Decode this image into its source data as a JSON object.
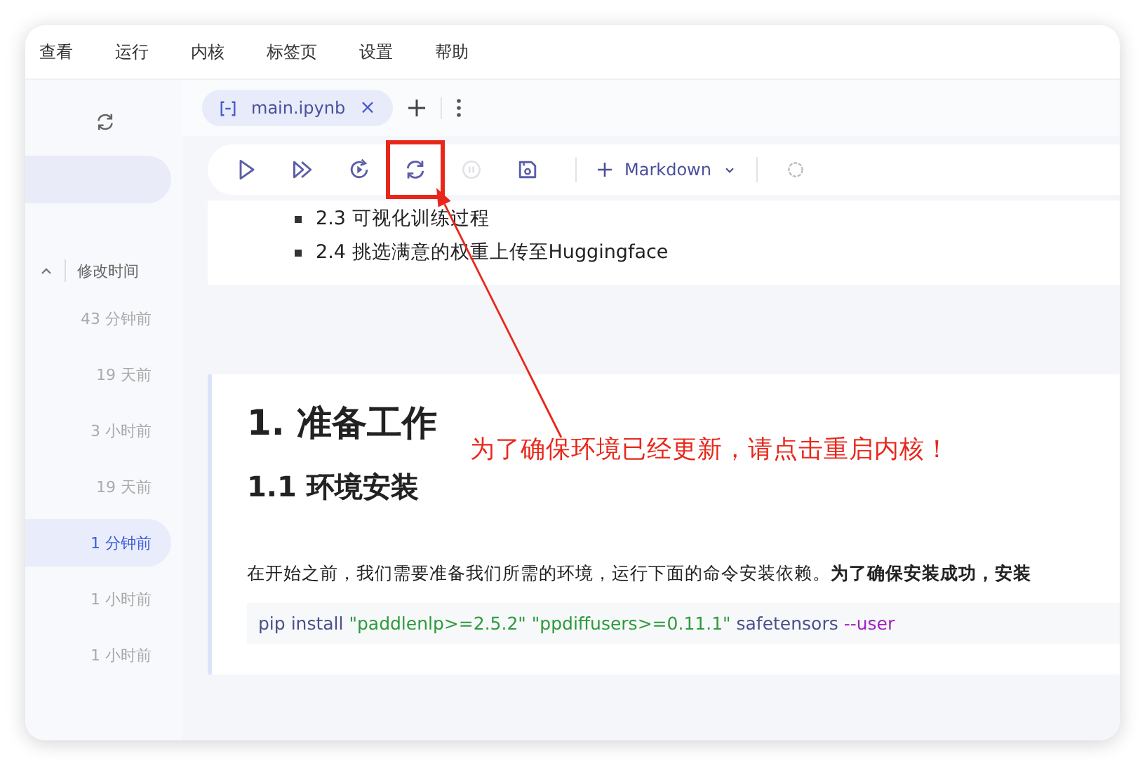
{
  "menu": [
    "查看",
    "运行",
    "内核",
    "标签页",
    "设置",
    "帮助"
  ],
  "sidebar": {
    "nav_pill": {
      "selected": true
    },
    "sort": {
      "label": "修改时间",
      "expanded": true
    },
    "items": [
      {
        "label": "43 分钟前",
        "selected": false
      },
      {
        "label": "19 天前",
        "selected": false
      },
      {
        "label": "3 小时前",
        "selected": false
      },
      {
        "label": "19 天前",
        "selected": false
      },
      {
        "label": "1 分钟前",
        "selected": true
      },
      {
        "label": "1 小时前",
        "selected": false
      },
      {
        "label": "1 小时前",
        "selected": false
      }
    ]
  },
  "tabs": [
    {
      "label": "main.ipynb",
      "close": "×",
      "selected": true
    }
  ],
  "toolbar": {
    "buttons": [
      {
        "kind": "run",
        "disabled": false,
        "boxed": false
      },
      {
        "kind": "run-all",
        "disabled": false,
        "boxed": false
      },
      {
        "kind": "restart-run",
        "disabled": false,
        "boxed": false
      },
      {
        "kind": "restart",
        "disabled": false,
        "boxed": true
      },
      {
        "kind": "interrupt",
        "disabled": true,
        "boxed": false
      },
      {
        "kind": "save",
        "disabled": false,
        "boxed": false
      }
    ],
    "insert": {
      "label": "Markdown"
    }
  },
  "cells": [
    {
      "kind": "list",
      "items": [
        "2.3 可视化训练过程",
        "2.4 挑选满意的权重上传至Huggingface"
      ]
    },
    {
      "kind": "section",
      "h1": "1. 准备工作",
      "h2": "1.1 环境安装",
      "paragraph": "在开始之前，我们需要准备我们所需的环境，运行下面的命令安装依赖。**为了确保安装成功，安装**",
      "code": [
        {
          "kind": "plain",
          "text": "pip install "
        },
        {
          "kind": "string",
          "text": "\"paddlenlp>=2.5.2\" \"ppdiffusers>=0.11.1\""
        },
        {
          "kind": "plain",
          "text": " safetensors "
        },
        {
          "kind": "flag",
          "text": "--user"
        }
      ]
    }
  ],
  "annotation": {
    "text": "为了确保环境已经更新，请点击重启内核！"
  }
}
